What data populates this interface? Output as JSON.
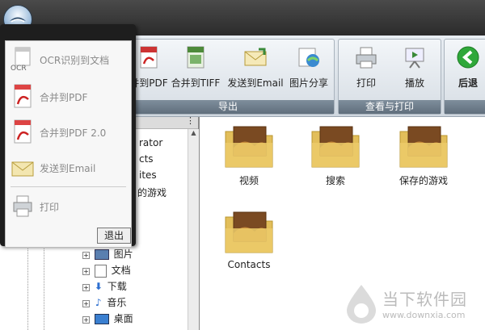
{
  "ribbon": {
    "export_group": {
      "label": "导出",
      "buttons": [
        {
          "label": "并到PDF",
          "icon": "pdf-merge-icon"
        },
        {
          "label": "合并到TIFF",
          "icon": "tiff-icon"
        },
        {
          "label": "发送到Email",
          "icon": "email-icon"
        },
        {
          "label": "图片分享",
          "icon": "image-share-icon"
        }
      ]
    },
    "view_print_group": {
      "label": "查看与打印",
      "buttons": [
        {
          "label": "打印",
          "icon": "printer-icon"
        },
        {
          "label": "播放",
          "icon": "slideshow-icon"
        }
      ]
    },
    "nav_group": {
      "buttons": [
        {
          "label": "后退",
          "icon": "back-arrow-icon"
        }
      ]
    }
  },
  "app_menu": {
    "items": [
      {
        "label": "OCR识别到文档",
        "icon": "ocr-icon"
      },
      {
        "label": "合并到PDF",
        "icon": "pdf-icon"
      },
      {
        "label": "合并到PDF 2.0",
        "icon": "pdf-icon"
      },
      {
        "label": "发送到Email",
        "icon": "email-icon"
      },
      {
        "label": "打印",
        "icon": "printer-icon"
      }
    ],
    "exit_label": "退出"
  },
  "tree": {
    "partial": [
      "rator",
      "cts",
      "ites",
      "的游戏"
    ],
    "items": [
      {
        "label": "图片",
        "icon": "picture-folder-icon"
      },
      {
        "label": "文档",
        "icon": "document-folder-icon"
      },
      {
        "label": "下载",
        "icon": "download-folder-icon"
      },
      {
        "label": "音乐",
        "icon": "music-folder-icon"
      },
      {
        "label": "桌面",
        "icon": "desktop-folder-icon"
      }
    ]
  },
  "files": [
    {
      "label": "视频"
    },
    {
      "label": "搜索"
    },
    {
      "label": "保存的游戏"
    },
    {
      "label": "Contacts"
    }
  ],
  "watermark": {
    "name": "当下软件园",
    "url": "www.downxia.com"
  },
  "colors": {
    "accent_green": "#2fa83a",
    "group_label_bg": "#6b7a88",
    "menu_bg": "#1e1e1e"
  }
}
